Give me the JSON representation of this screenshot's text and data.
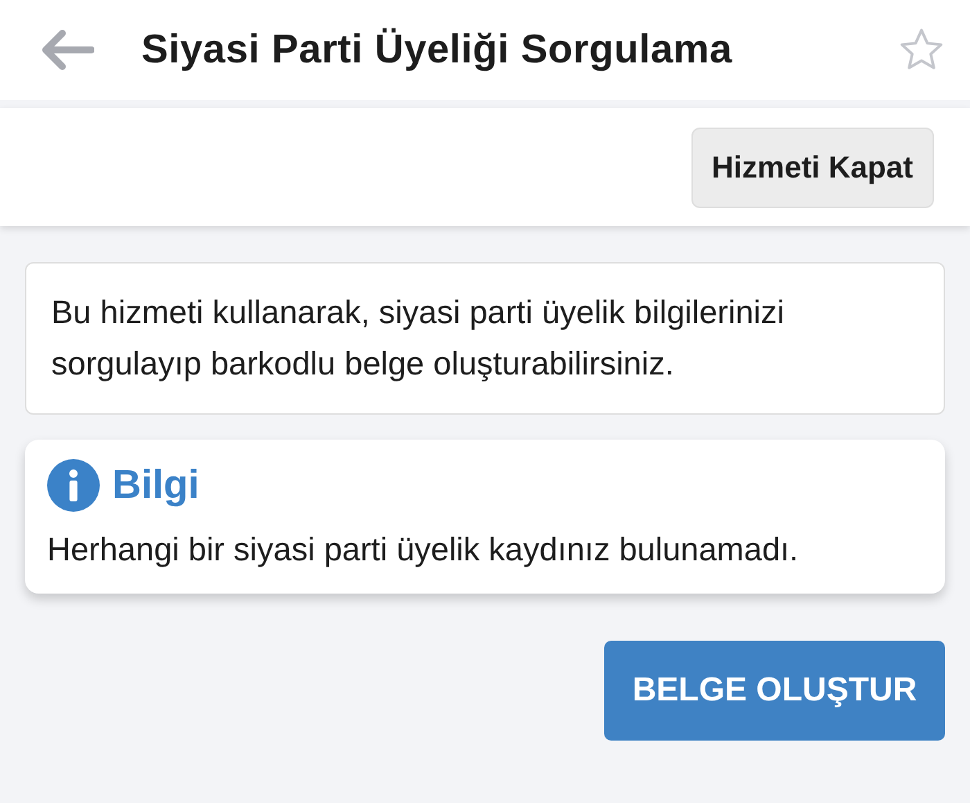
{
  "header": {
    "title": "Siyasi Parti Üyeliği Sorgulama",
    "favorite": false
  },
  "toolbar": {
    "button": "Hizmeti Kapat"
  },
  "description": "Bu hizmeti kullanarak, siyasi parti üyelik bilgilerinizi sorgulayıp barkodlu belge oluşturabilirsiniz.",
  "notice": {
    "kind": "info",
    "title": "Bilgi",
    "message": "Herhangi bir siyasi parti üyelik kaydınız bulunamadı."
  },
  "primary_button": "BELGE OLUŞTUR"
}
